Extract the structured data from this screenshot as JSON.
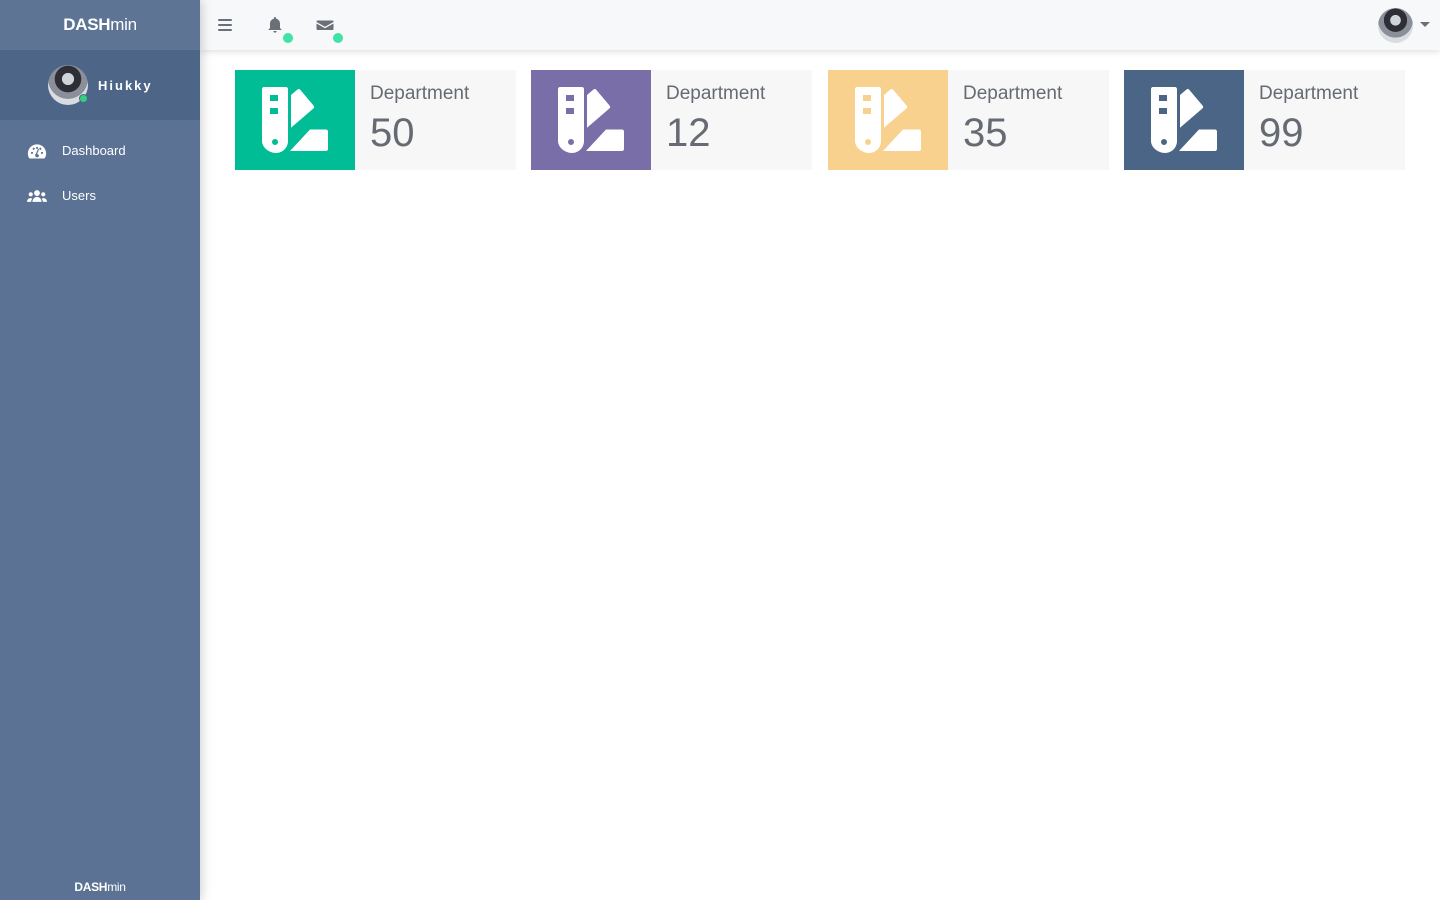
{
  "brand": {
    "bold": "DASH",
    "thin": "min"
  },
  "user": {
    "name": "Hiukky",
    "status_color": "#35d07f"
  },
  "menu": [
    {
      "label": "Dashboard",
      "icon": "tachometer-icon"
    },
    {
      "label": "Users",
      "icon": "users-icon"
    }
  ],
  "footer": {
    "bold": "DASH",
    "thin": "min"
  },
  "topbar": {
    "icons": [
      "menu-icon",
      "bell-icon",
      "envelope-icon"
    ],
    "notification_dot_color": "#41e2a4"
  },
  "cards": [
    {
      "label": "Department",
      "value": "50",
      "color": "#00bd96",
      "icon": "swatchbook-icon"
    },
    {
      "label": "Department",
      "value": "12",
      "color": "#7a6ea8",
      "icon": "swatchbook-icon"
    },
    {
      "label": "Department",
      "value": "35",
      "color": "#f9d18e",
      "icon": "swatchbook-icon"
    },
    {
      "label": "Department",
      "value": "99",
      "color": "#4b6586",
      "icon": "swatchbook-icon"
    }
  ],
  "colors": {
    "sidebar": "#5b7294",
    "sidebar_user_panel": "#4d6586",
    "topbar": "#f7f8fa",
    "card_bg": "#f7f7f7",
    "text": "#666b73"
  }
}
